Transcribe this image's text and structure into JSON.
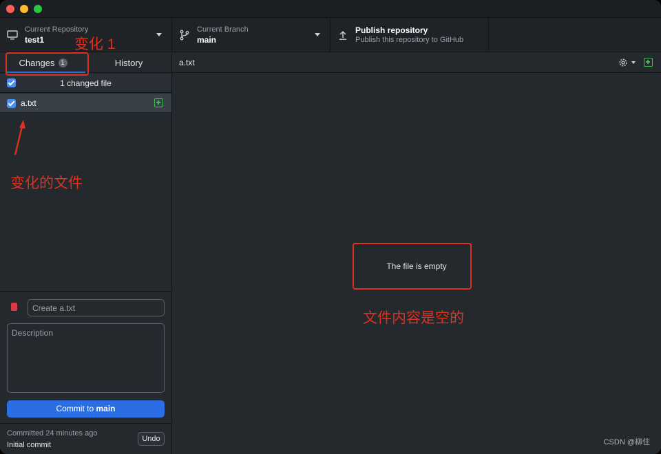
{
  "toolbar": {
    "repository": {
      "label": "Current Repository",
      "value": "test1"
    },
    "branch": {
      "label": "Current Branch",
      "value": "main"
    },
    "publish": {
      "label": "Publish repository",
      "sub": "Publish this repository to GitHub"
    }
  },
  "tabs": {
    "changes": {
      "label": "Changes",
      "badge": "1"
    },
    "history": {
      "label": "History"
    }
  },
  "changes": {
    "count_text": "1 changed file",
    "files": [
      {
        "name": "a.txt",
        "status": "added"
      }
    ]
  },
  "commit": {
    "summary_placeholder": "Create a.txt",
    "description_placeholder": "Description",
    "button_prefix": "Commit to ",
    "button_branch": "main"
  },
  "last_commit": {
    "meta": "Committed 24 minutes ago",
    "message": "Initial commit",
    "undo_label": "Undo"
  },
  "main": {
    "file_title": "a.txt",
    "empty_message": "The file is empty"
  },
  "annotations": {
    "changes_note": "变化 1",
    "file_note": "变化的文件",
    "empty_note": "文件内容是空的"
  },
  "watermark": "CSDN @柳住",
  "colors": {
    "accent": "#2b6de3",
    "annotation": "#e0301e",
    "added": "#3fb950"
  }
}
